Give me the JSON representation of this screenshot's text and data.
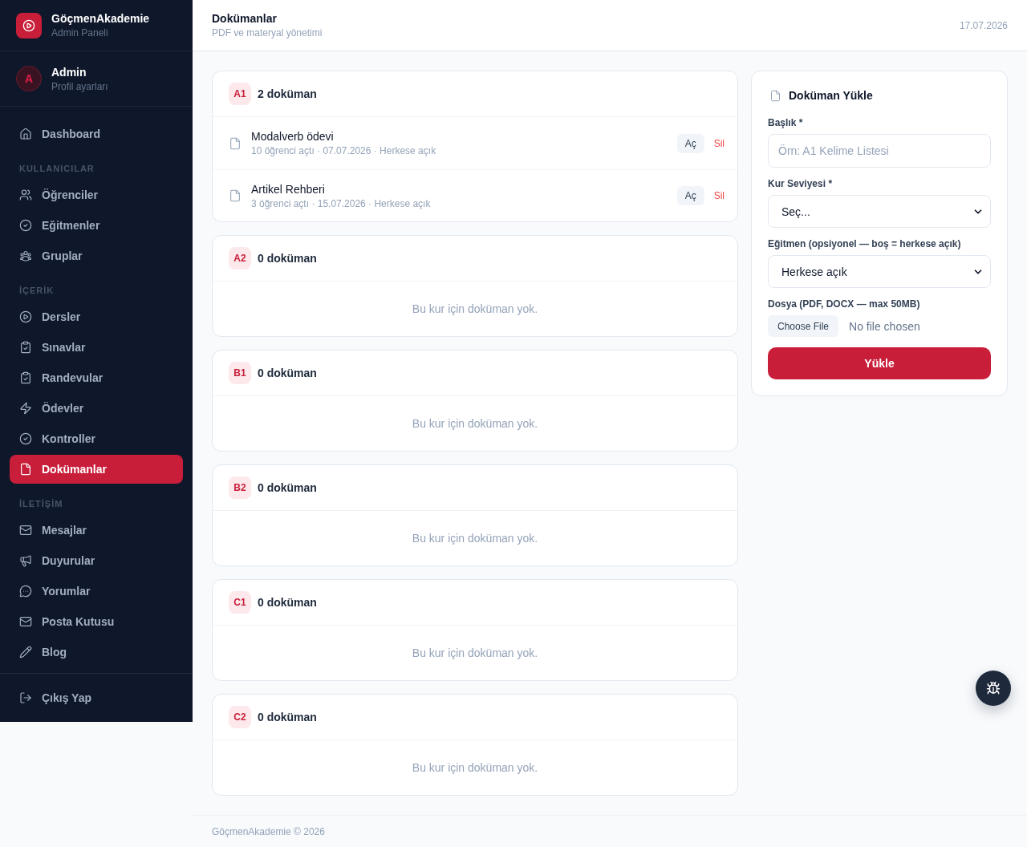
{
  "sidebar": {
    "brand": {
      "title": "GöçmenAkademie",
      "subtitle": "Admin Paneli"
    },
    "profile": {
      "initial": "A",
      "name": "Admin",
      "link": "Profil ayarları"
    },
    "nav": [
      {
        "kind": "item",
        "label": "Dashboard",
        "selected": false
      },
      {
        "kind": "heading",
        "label": "KULLANICILAR"
      },
      {
        "kind": "item",
        "label": "Öğrenciler",
        "selected": false
      },
      {
        "kind": "item",
        "label": "Eğitmenler",
        "selected": false
      },
      {
        "kind": "item",
        "label": "Gruplar",
        "selected": false
      },
      {
        "kind": "heading",
        "label": "İÇERİK"
      },
      {
        "kind": "item",
        "label": "Dersler",
        "selected": false
      },
      {
        "kind": "item",
        "label": "Sınavlar",
        "selected": false
      },
      {
        "kind": "item",
        "label": "Randevular",
        "selected": false
      },
      {
        "kind": "item",
        "label": "Ödevler",
        "selected": false
      },
      {
        "kind": "item",
        "label": "Kontroller",
        "selected": false
      },
      {
        "kind": "item",
        "label": "Dokümanlar",
        "selected": true
      },
      {
        "kind": "heading",
        "label": "İLETİŞİM"
      },
      {
        "kind": "item",
        "label": "Mesajlar",
        "selected": false
      },
      {
        "kind": "item",
        "label": "Duyurular",
        "selected": false
      },
      {
        "kind": "item",
        "label": "Yorumlar",
        "selected": false
      },
      {
        "kind": "item",
        "label": "Posta Kutusu",
        "selected": false
      },
      {
        "kind": "item",
        "label": "Blog",
        "selected": false
      }
    ],
    "logout": "Çıkış Yap"
  },
  "header": {
    "title": "Dokümanlar",
    "subtitle": "PDF ve materyal yönetimi",
    "date": "17.07.2026"
  },
  "levels": [
    {
      "badge": "A1",
      "count": "2 doküman",
      "documents": [
        {
          "title": "Modalverb ödevi",
          "meta": "10 öğrenci açtı · 07.07.2026 · Herkese açık",
          "open": "Aç",
          "delete": "Sil"
        },
        {
          "title": "Artikel Rehberi",
          "meta": "3 öğrenci açtı · 15.07.2026 · Herkese açık",
          "open": "Aç",
          "delete": "Sil"
        }
      ]
    },
    {
      "badge": "A2",
      "count": "0 doküman",
      "empty_text": "Bu kur için doküman yok."
    },
    {
      "badge": "B1",
      "count": "0 doküman",
      "empty_text": "Bu kur için doküman yok."
    },
    {
      "badge": "B2",
      "count": "0 doküman",
      "empty_text": "Bu kur için doküman yok."
    },
    {
      "badge": "C1",
      "count": "0 doküman",
      "empty_text": "Bu kur için doküman yok."
    },
    {
      "badge": "C2",
      "count": "0 doküman",
      "empty_text": "Bu kur için doküman yok."
    }
  ],
  "upload": {
    "title": "Doküman Yükle",
    "fields": [
      {
        "kind": "text",
        "label": "Başlık *",
        "placeholder": "Örn: A1 Kelime Listesi"
      },
      {
        "kind": "select",
        "label": "Kur Seviyesi *",
        "value": "Seç..."
      },
      {
        "kind": "select",
        "label": "Eğitmen (opsiyonel — boş = herkese açık)",
        "value": "Herkese açık"
      },
      {
        "kind": "file",
        "label": "Dosya (PDF, DOCX — max 50MB)",
        "button": "Choose File",
        "value": "No file chosen"
      }
    ],
    "submit": "Yükle"
  },
  "footer": "GöçmenAkademie © 2026"
}
